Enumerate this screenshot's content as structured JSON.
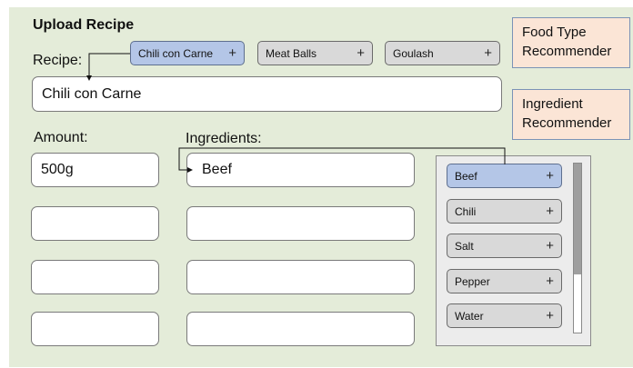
{
  "title": "Upload Recipe",
  "recipe": {
    "label": "Recipe:",
    "suggestions": [
      {
        "label": "Chili con Carne",
        "plus": "+",
        "selected": true
      },
      {
        "label": "Meat Balls",
        "plus": "+",
        "selected": false
      },
      {
        "label": "Goulash",
        "plus": "+",
        "selected": false
      }
    ],
    "value": "Chili con Carne"
  },
  "amount": {
    "label": "Amount:",
    "values": [
      "500g",
      "",
      "",
      ""
    ]
  },
  "ingredients": {
    "label": "Ingredients:",
    "values": [
      "Beef",
      "",
      "",
      ""
    ]
  },
  "ingredient_list": [
    {
      "label": "Beef",
      "plus": "+",
      "selected": true
    },
    {
      "label": "Chili",
      "plus": "+",
      "selected": false
    },
    {
      "label": "Salt",
      "plus": "+",
      "selected": false
    },
    {
      "label": "Pepper",
      "plus": "+",
      "selected": false
    },
    {
      "label": "Water",
      "plus": "+",
      "selected": false
    }
  ],
  "recommenders": {
    "food_type": "Food Type Recommender",
    "ingredient": "Ingredient Recommender"
  },
  "colors": {
    "panel": "#e4ecd9",
    "chip": "#d9d9d9",
    "chip_selected": "#b4c6e7",
    "recommender": "#fbe5d6"
  }
}
